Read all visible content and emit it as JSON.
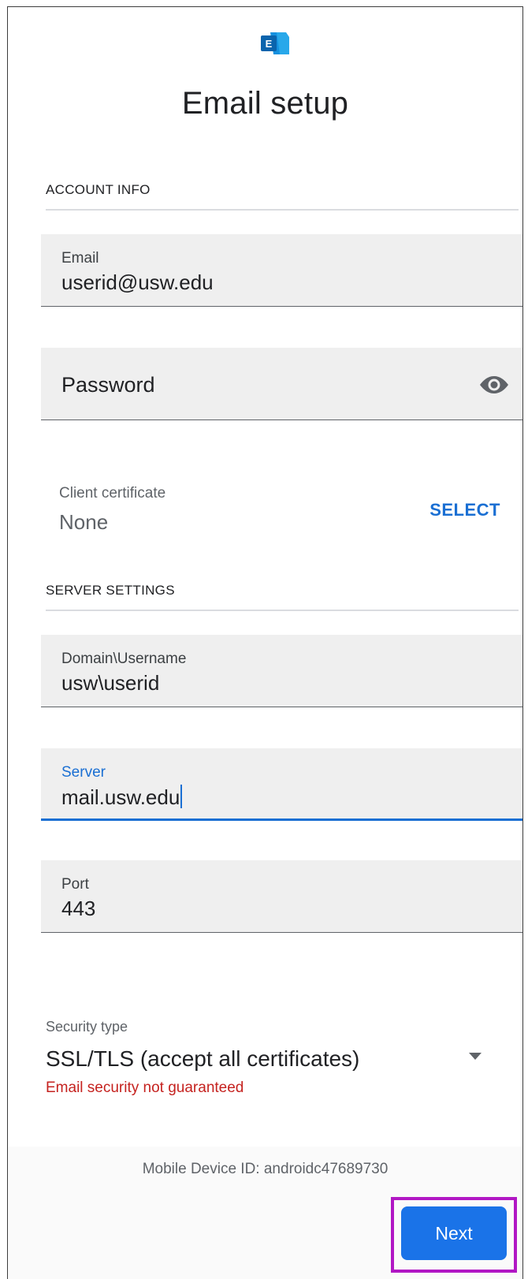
{
  "header": {
    "title": "Email setup",
    "logo_icon": "exchange-logo-icon",
    "logo_letter": "E"
  },
  "account_info": {
    "section_title": "ACCOUNT INFO",
    "email": {
      "label": "Email",
      "value": "userid@usw.edu"
    },
    "password": {
      "placeholder": "Password",
      "toggle_icon": "eye-icon"
    },
    "client_certificate": {
      "label": "Client certificate",
      "value": "None",
      "action": "SELECT"
    }
  },
  "server_settings": {
    "section_title": "SERVER SETTINGS",
    "username": {
      "label": "Domain\\Username",
      "value": "usw\\userid"
    },
    "server": {
      "label": "Server",
      "value": "mail.usw.edu"
    },
    "port": {
      "label": "Port",
      "value": "443"
    },
    "security": {
      "label": "Security type",
      "value": "SSL/TLS (accept all certificates)",
      "warning": "Email security not guaranteed",
      "dropdown_icon": "dropdown-arrow-icon"
    }
  },
  "footer": {
    "device_id": "Mobile Device ID: androidc47689730",
    "next_label": "Next"
  },
  "colors": {
    "accent": "#1a73e8",
    "warning": "#c5221f",
    "highlight": "#b117c4",
    "field_bg": "#efefef"
  }
}
